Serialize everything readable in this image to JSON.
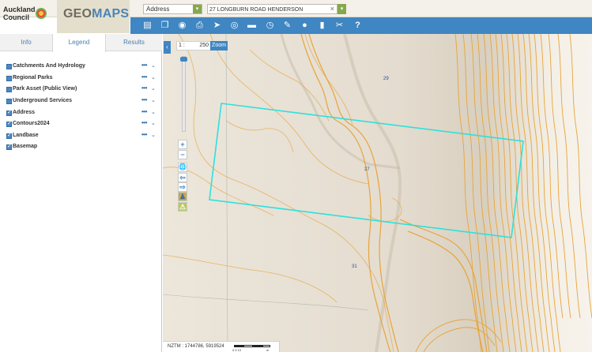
{
  "header": {
    "logo_line1": "Auckland",
    "logo_line2": "Council",
    "app_name_part1": "GEO",
    "app_name_part2": "MAPS",
    "search_type": "Address",
    "search_value": "27 LONGBURN ROAD HENDERSON",
    "clear_glyph": "×",
    "dropdown_glyph": "▾"
  },
  "toolbar": {
    "icons": [
      "map-book-icon",
      "layers-copy-icon",
      "view-eye-icon",
      "print-icon",
      "select-pointer-icon",
      "locate-target-icon",
      "measure-ruler-icon",
      "history-clock-icon",
      "draw-pencil-icon",
      "place-pin-icon",
      "bookmark-icon",
      "tools-icon",
      "help-icon"
    ],
    "glyphs": [
      "▤",
      "❐",
      "◉",
      "⎙",
      "➤",
      "◎",
      "▬",
      "◷",
      "✎",
      "●",
      "▮",
      "✂",
      "?"
    ]
  },
  "panel": {
    "tabs": [
      {
        "label": "Info",
        "active": false
      },
      {
        "label": "Legend",
        "active": true
      },
      {
        "label": "Results",
        "active": false
      }
    ],
    "layers": [
      {
        "name": "Catchments And Hydrology",
        "checked": false,
        "has_menu": true
      },
      {
        "name": "Regional Parks",
        "checked": false,
        "has_menu": true
      },
      {
        "name": "Park Asset (Public View)",
        "checked": false,
        "has_menu": true
      },
      {
        "name": "Underground Services",
        "checked": false,
        "has_menu": true
      },
      {
        "name": "Address",
        "checked": true,
        "has_menu": true
      },
      {
        "name": "Contours2024",
        "checked": true,
        "has_menu": true
      },
      {
        "name": "Landbase",
        "checked": true,
        "has_menu": true
      },
      {
        "name": "Basemap",
        "checked": true,
        "has_menu": false
      }
    ],
    "menu_glyph": "•••",
    "chevron_glyph": "⌄"
  },
  "map": {
    "scale_prefix": "1 :",
    "scale_value": "250",
    "zoom_label": "Zoom",
    "collapse_glyph": "‹",
    "controls": [
      "+",
      "−",
      "🌐",
      "⇦",
      "⇨",
      "♟",
      "⚠"
    ],
    "coords_label": "NZTM : 1744786, 5919524",
    "scalebar_ticks": "0    5    10",
    "scalebar_unit": "m",
    "parcel_labels": [
      "29",
      "27",
      "31"
    ],
    "colors": {
      "parcel_outline": "#2ee0dc",
      "contour": "#e7a43a",
      "toolbar": "#3f86c2",
      "accent_green": "#85a84d"
    }
  }
}
